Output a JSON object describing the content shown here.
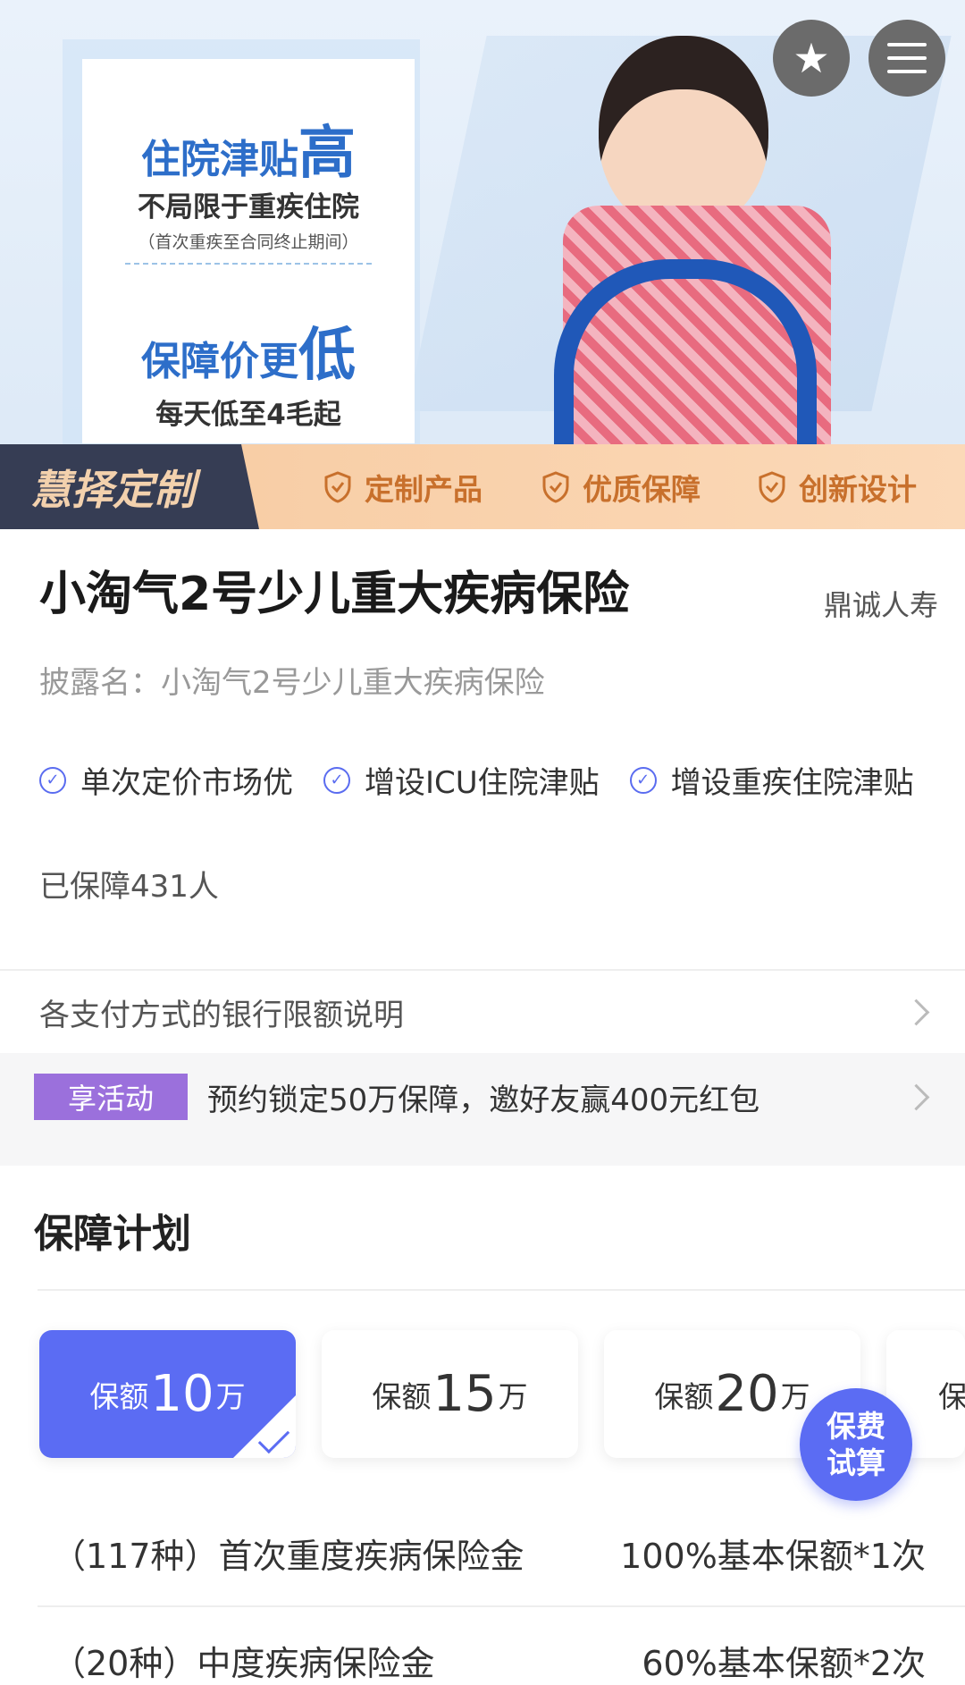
{
  "banner": {
    "card_line1": "住院津贴",
    "card_line1_big": "高",
    "card_line2": "不局限于重疾住院",
    "card_line3": "（首次重疾至合同终止期间）",
    "card_line4": "保障价更",
    "card_line4_big": "低",
    "card_line5": "每天低至4毛起",
    "ribbon_brand": "慧择定制",
    "features": [
      "定制产品",
      "优质保障",
      "创新设计"
    ]
  },
  "product": {
    "title": "小淘气2号少儿重大疾病保险",
    "company": "鼎诚人寿",
    "disclosure": "披露名：小淘气2号少儿重大疾病保险",
    "tags": [
      "单次定价市场优",
      "增设ICU住院津贴",
      "增设重疾住院津贴"
    ],
    "protected_count": "已保障431人"
  },
  "bank_limit": {
    "label": "各支付方式的银行限额说明"
  },
  "activity": {
    "badge": "享活动",
    "text": "预约锁定50万保障，邀好友赢400元红包"
  },
  "plan": {
    "title": "保障计划",
    "options": [
      {
        "prefix": "保额",
        "amount": "10",
        "unit": "万",
        "selected": true
      },
      {
        "prefix": "保额",
        "amount": "15",
        "unit": "万",
        "selected": false
      },
      {
        "prefix": "保额",
        "amount": "20",
        "unit": "万",
        "selected": false
      },
      {
        "prefix": "保",
        "amount": "",
        "unit": "",
        "selected": false
      }
    ],
    "calc_button": [
      "保费",
      "试算"
    ],
    "benefits": [
      {
        "name": "（117种）首次重度疾病保险金",
        "value": "100%基本保额*1次"
      },
      {
        "name": "（20种）中度疾病保险金",
        "value": "60%基本保额*2次"
      }
    ]
  },
  "colors": {
    "accent": "#5b6cf3",
    "activity_badge": "#9b70dc",
    "ribbon_text": "#c8702c"
  }
}
